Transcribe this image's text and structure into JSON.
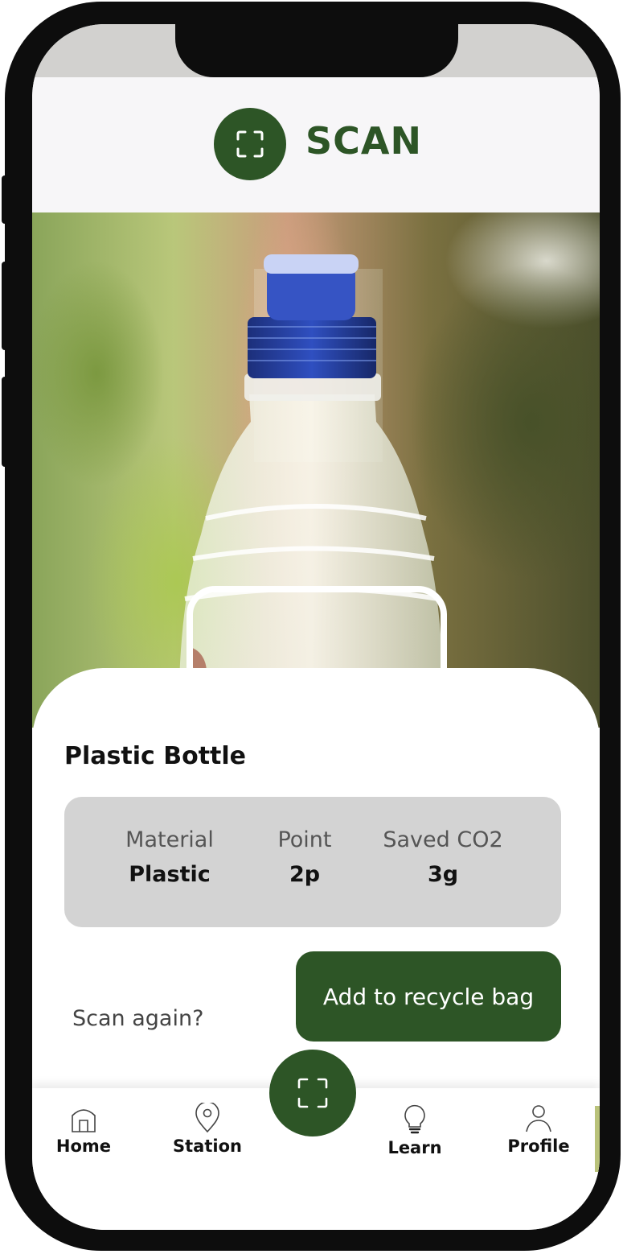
{
  "header": {
    "title": "SCAN",
    "icon": "scan-frame-icon"
  },
  "product": {
    "name": "Plastic Bottle",
    "details": [
      {
        "label": "Material",
        "value": "Plastic"
      },
      {
        "label": "Point",
        "value": "2p"
      },
      {
        "label": "Saved CO2",
        "value": "3g"
      }
    ]
  },
  "actions": {
    "add_label": "Add to recycle bag",
    "rescan_label": "Scan again?"
  },
  "tabbar": {
    "items": [
      {
        "label": "Home",
        "icon": "home-icon"
      },
      {
        "label": "Station",
        "icon": "location-pin-icon"
      },
      {
        "label": "Learn",
        "icon": "lightbulb-icon"
      },
      {
        "label": "Profile",
        "icon": "user-icon"
      }
    ],
    "center_icon": "scan-frame-icon"
  },
  "colors": {
    "brand_green": "#2d5526",
    "info_box": "#d3d3d3",
    "header_bg": "#f7f6f8",
    "bottle_cap": "#1f3c9e"
  }
}
